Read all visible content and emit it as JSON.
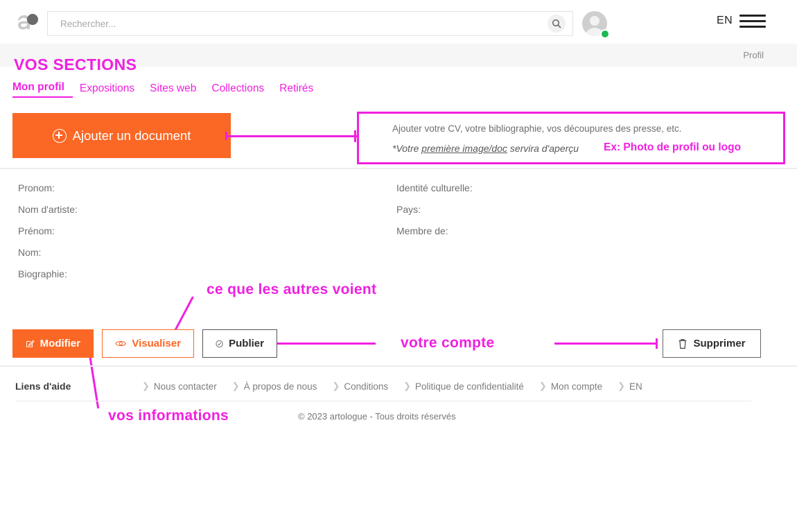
{
  "colors": {
    "orange": "#fb6724",
    "magenta": "#f020e0",
    "gray_band": "#f6f6f6",
    "online_green": "#1db954"
  },
  "topbar": {
    "logo_alt": "artologue-logo",
    "search": {
      "placeholder": "Rechercher...",
      "value": ""
    },
    "search_button_icon": "search-icon",
    "avatar_icon": "avatar-icon",
    "status": "online",
    "lang": "EN",
    "menu_icon": "hamburger-menu-icon"
  },
  "graybar": {
    "breadcrumb": "Profil"
  },
  "sections": {
    "title": "VOS SECTIONS",
    "tabs": [
      {
        "label": "Mon profil",
        "active": true
      },
      {
        "label": "Expositions",
        "active": false
      },
      {
        "label": "Sites web",
        "active": false
      },
      {
        "label": "Collections",
        "active": false
      },
      {
        "label": "Retirés",
        "active": false
      }
    ]
  },
  "add_document": {
    "label": "Ajouter un document",
    "icon": "plus-circle-icon"
  },
  "callout": {
    "line1": "Ajouter votre CV, votre bibliographie, vos découpures des presse, etc.",
    "line2_prefix": "*Votre ",
    "line2_underlined": "première image/doc",
    "line2_suffix": " servira d'aperçu",
    "example": "Ex: Photo de profil ou logo"
  },
  "profile_fields": {
    "left": [
      "Pronom:",
      "Nom d'artiste:",
      "Prénom:",
      "Nom:",
      "Biographie:"
    ],
    "right": [
      "Identité culturelle:",
      "Pays:",
      "Membre de:"
    ]
  },
  "annotations": [
    {
      "id": "ce-que-les-autres-voient",
      "text": "ce que les autres voient"
    },
    {
      "id": "votre-compte",
      "text": "votre compte"
    },
    {
      "id": "vos-informations",
      "text": "vos informations"
    }
  ],
  "actions": {
    "modifier": {
      "label": "Modifier",
      "icon": "edit-pencil-icon"
    },
    "visualiser": {
      "label": "Visualiser",
      "icon": "eye-icon"
    },
    "publier": {
      "label": "Publier",
      "icon": "check-circle-icon"
    },
    "supprimer": {
      "label": "Supprimer",
      "icon": "trash-icon"
    }
  },
  "footer": {
    "heading": "Liens d'aide",
    "links": [
      "Nous contacter",
      "À propos de nous",
      "Conditions",
      "Politique de confidentialité",
      "Mon compte",
      "EN"
    ],
    "chevron": "❯",
    "copyright": "© 2023 artologue - Tous droits réservés"
  }
}
